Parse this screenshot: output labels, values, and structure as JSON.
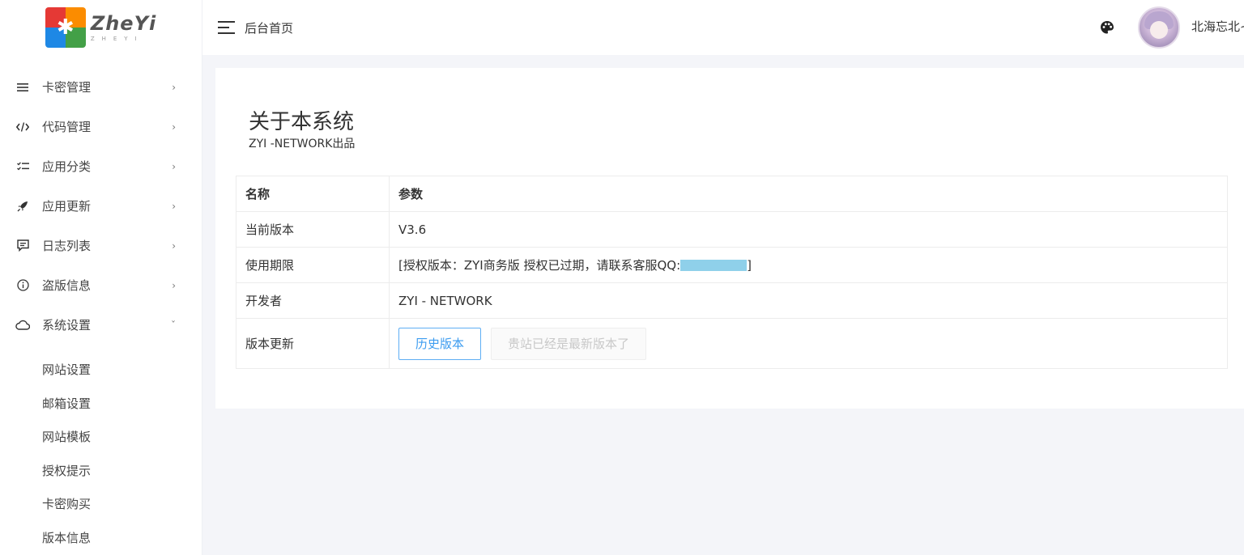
{
  "logo": {
    "title": "ZheYi",
    "subtitle": "ZHEYI"
  },
  "sidebar": {
    "items": [
      {
        "label": "卡密管理",
        "icon": "list-icon"
      },
      {
        "label": "代码管理",
        "icon": "code-icon"
      },
      {
        "label": "应用分类",
        "icon": "checklist-icon"
      },
      {
        "label": "应用更新",
        "icon": "rocket-icon"
      },
      {
        "label": "日志列表",
        "icon": "comment-icon"
      },
      {
        "label": "盗版信息",
        "icon": "info-icon"
      },
      {
        "label": "系统设置",
        "icon": "cloud-icon",
        "expanded": true
      }
    ],
    "submenu": [
      "网站设置",
      "邮箱设置",
      "网站模板",
      "授权提示",
      "卡密购买",
      "版本信息"
    ]
  },
  "header": {
    "title": "后台首页",
    "username": "北海忘北~"
  },
  "about": {
    "title": "关于本系统",
    "subtitle": "ZYI -NETWORK出品"
  },
  "table": {
    "headers": [
      "名称",
      "参数"
    ],
    "rows": [
      {
        "name": "当前版本",
        "value": "V3.6"
      },
      {
        "name": "使用期限",
        "value_prefix": "[授权版本：ZYI商务版 授权已过期，请联系客服QQ:",
        "value_suffix": "]"
      },
      {
        "name": "开发者",
        "value": "ZYI - NETWORK"
      },
      {
        "name": "版本更新",
        "button_primary": "历史版本",
        "button_disabled": "贵站已经是最新版本了"
      }
    ]
  },
  "colors": {
    "accent": "#3c9cf0",
    "background": "#f4f5f9",
    "qq_mask": "#8fd0ea"
  }
}
